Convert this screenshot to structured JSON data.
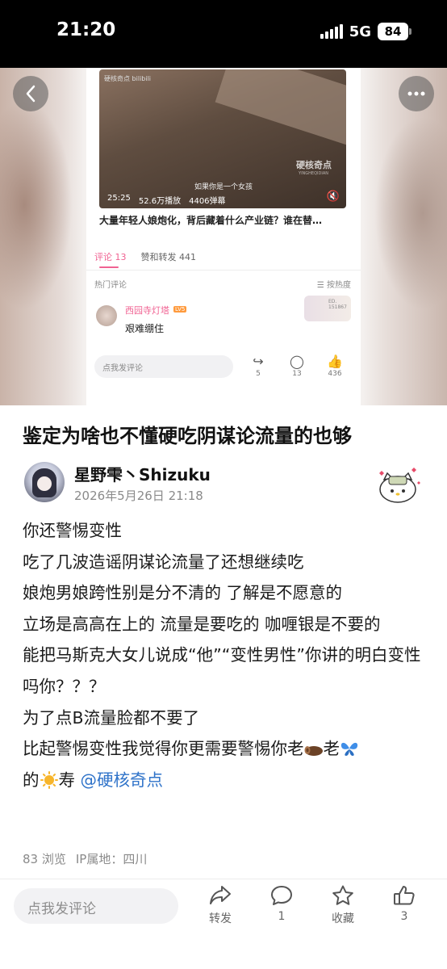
{
  "status_bar": {
    "time": "21:20",
    "network": "5G",
    "battery": "84"
  },
  "screenshot": {
    "video": {
      "logo": "硬核奇点 bilibili",
      "watermark": "硬核奇点",
      "watermark_sub": "YINGHEQIDIAN",
      "subtitle": "如果你是一个女孩",
      "duration": "25:25",
      "plays": "52.6万播放",
      "danmaku": "4406弹幕",
      "title": "大量年轻人娘炮化，背后藏着什么产业链？谁在替…"
    },
    "tabs": {
      "comments": "评论 13",
      "reposts": "赞和转发 441"
    },
    "hot_label": "热门评论",
    "sort_label": "☰ 按热度",
    "comment": {
      "name": "西园寺灯塔",
      "level": "LV5",
      "text": "艰难绷住",
      "sticker": "ED. 151867"
    },
    "bar": {
      "input": "点我发评论",
      "share": "5",
      "comment": "13",
      "like": "436"
    }
  },
  "post": {
    "title": "鉴定为啥也不懂硬吃阴谋论流量的也够",
    "author": "星野雫丶Shizuku",
    "date": "2026年5月26日 21:18",
    "lines": [
      "你还警惕变性",
      "吃了几波造谣阴谋论流量了还想继续吃",
      "娘炮男娘跨性别是分不清的 了解是不愿意的",
      "立场是高高在上的 流量是要吃的 咖喱银是不要的",
      "能把马斯克大女儿说成“他”“变性男性”你讲的明白变性吗你？？？",
      "为了点B流量脸都不要了"
    ],
    "last_line_a": "比起警惕变性我觉得你更需要警惕你老",
    "last_line_b": "老",
    "last_line_c": "的",
    "last_line_d": "寿",
    "mention": "@硬核奇点",
    "views": "83 浏览",
    "ip": "IP属地：四川"
  },
  "bottom_bar": {
    "input_placeholder": "点我发评论",
    "share_label": "转发",
    "comment_count": "1",
    "fav_label": "收藏",
    "like_count": "3"
  }
}
